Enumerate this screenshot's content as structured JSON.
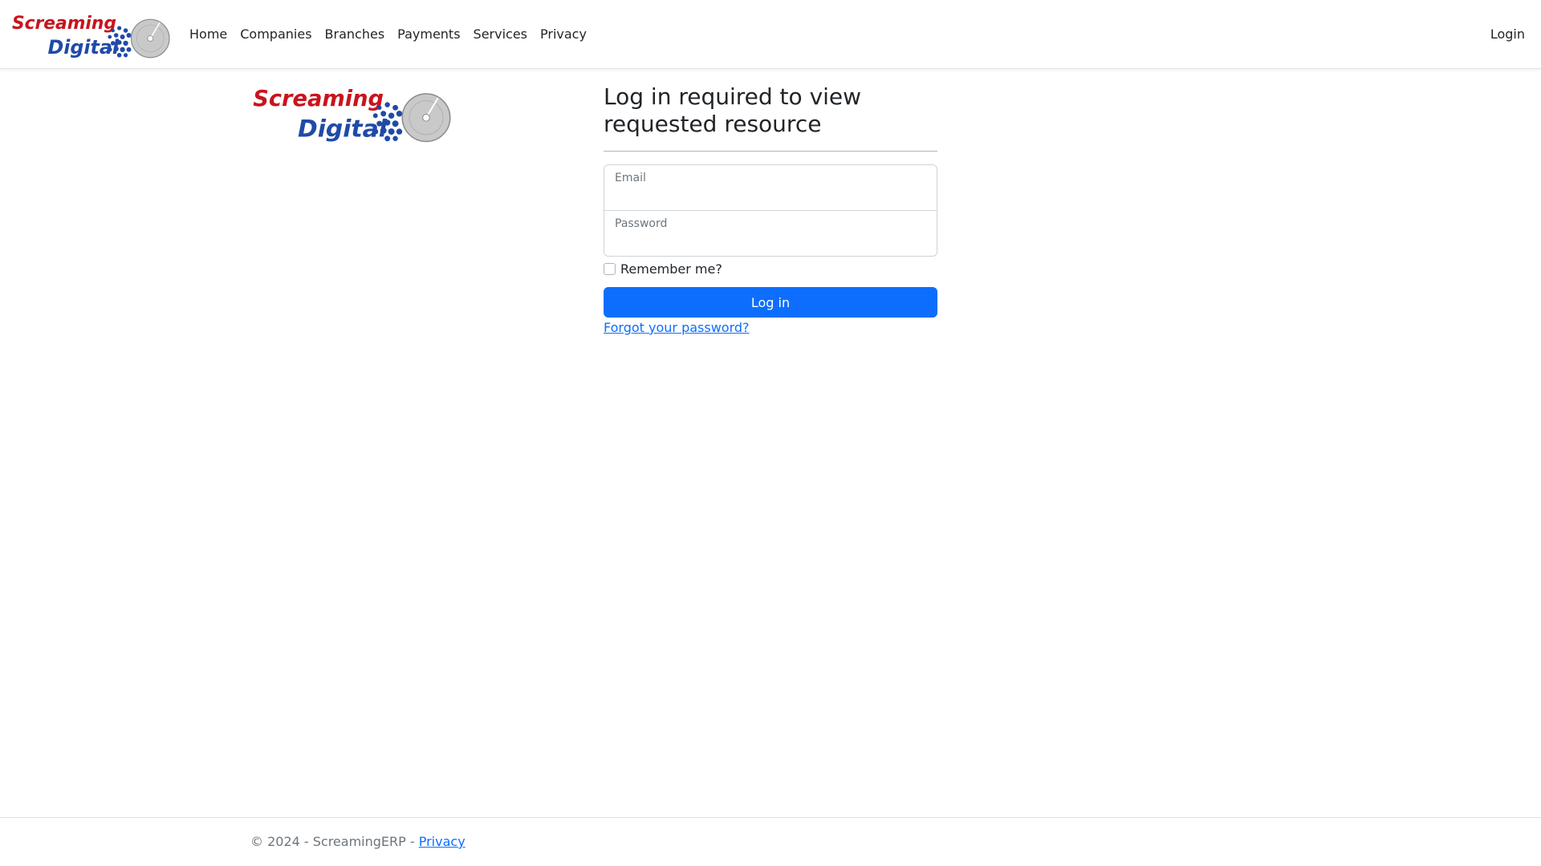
{
  "brand": {
    "logo_line1": "Screaming",
    "logo_line2": "Digital",
    "colors": {
      "red": "#c8141e",
      "blue": "#1f4aa8",
      "disc": "#c9c9c9"
    }
  },
  "nav": {
    "items": [
      {
        "label": "Home"
      },
      {
        "label": "Companies"
      },
      {
        "label": "Branches"
      },
      {
        "label": "Payments"
      },
      {
        "label": "Services"
      },
      {
        "label": "Privacy"
      }
    ],
    "login_label": "Login"
  },
  "login": {
    "heading": "Log in required to view requested resource",
    "email_label": "Email",
    "email_value": "",
    "password_label": "Password",
    "password_value": "",
    "remember_label": "Remember me?",
    "remember_checked": false,
    "submit_label": "Log in",
    "forgot_label": "Forgot your password?"
  },
  "footer": {
    "copyright": "© 2024 - ScreamingERP - ",
    "privacy_label": "Privacy"
  },
  "theme": {
    "primary": "#0d6efd",
    "text": "#212529",
    "muted": "#6c757d"
  }
}
